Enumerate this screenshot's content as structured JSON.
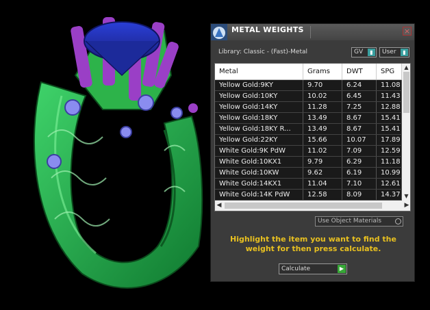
{
  "panel": {
    "title": "METAL WEIGHTS",
    "close_glyph": "×",
    "library_label": "Library: Classic - (Fast)-Metal",
    "gv_label": "GV",
    "user_label": "User",
    "table": {
      "columns": [
        "Metal",
        "Grams",
        "DWT",
        "SPG"
      ],
      "rows": [
        [
          "Yellow Gold:9KY",
          "9.70",
          "6.24",
          "11.08"
        ],
        [
          "Yellow Gold:10KY",
          "10.02",
          "6.45",
          "11.43"
        ],
        [
          "Yellow Gold:14KY",
          "11.28",
          "7.25",
          "12.88"
        ],
        [
          "Yellow Gold:18KY",
          "13.49",
          "8.67",
          "15.41"
        ],
        [
          "Yellow Gold:18KY R...",
          "13.49",
          "8.67",
          "15.41"
        ],
        [
          "Yellow Gold:22KY",
          "15.66",
          "10.07",
          "17.89"
        ],
        [
          "White Gold:9K PdW",
          "11.02",
          "7.09",
          "12.59"
        ],
        [
          "White Gold:10KX1",
          "9.79",
          "6.29",
          "11.18"
        ],
        [
          "White Gold:10KW",
          "9.62",
          "6.19",
          "10.99"
        ],
        [
          "White Gold:14KX1",
          "11.04",
          "7.10",
          "12.61"
        ],
        [
          "White Gold:14K PdW",
          "12.58",
          "8.09",
          "14.37"
        ]
      ]
    },
    "use_object_materials_label": "Use Object Materials",
    "instructions": "Highlight the item you want to find the weight for then press calculate.",
    "calculate_label": "Calculate",
    "colors": {
      "accent_text": "#e8c020",
      "metal_green": "#2db34a",
      "prong_purple": "#9a3fc6",
      "stone_blue": "#2a3fd8"
    }
  }
}
